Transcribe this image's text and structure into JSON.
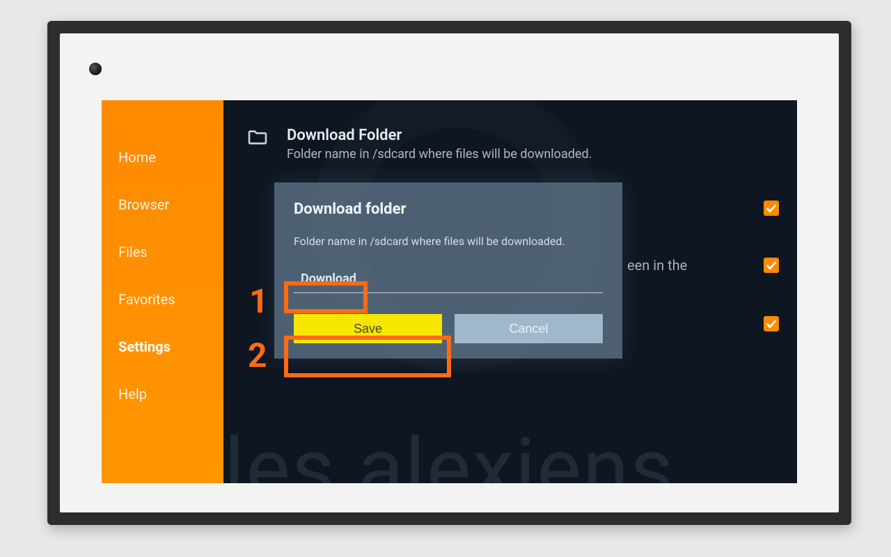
{
  "sidebar": {
    "items": [
      {
        "label": "Home"
      },
      {
        "label": "Browser"
      },
      {
        "label": "Files"
      },
      {
        "label": "Favorites"
      },
      {
        "label": "Settings"
      },
      {
        "label": "Help"
      }
    ],
    "active_index": 4
  },
  "header": {
    "title": "Download Folder",
    "subtitle": "Folder name in /sdcard where files will be downloaded."
  },
  "background_text_fragment": "een in the",
  "checkboxes": [
    {
      "checked": true
    },
    {
      "checked": true
    },
    {
      "checked": true
    }
  ],
  "dialog": {
    "title": "Download folder",
    "subtitle": "Folder name in /sdcard where files will be downloaded.",
    "input_value": "Download",
    "save_label": "Save",
    "cancel_label": "Cancel"
  },
  "annotations": {
    "num1": "1",
    "num2": "2"
  },
  "watermark": "les alexiens",
  "colors": {
    "accent_orange": "#ff8a00",
    "annotation_orange": "#ff6a13",
    "save_yellow": "#f6e600",
    "cancel_blue": "#9fb8cc"
  }
}
